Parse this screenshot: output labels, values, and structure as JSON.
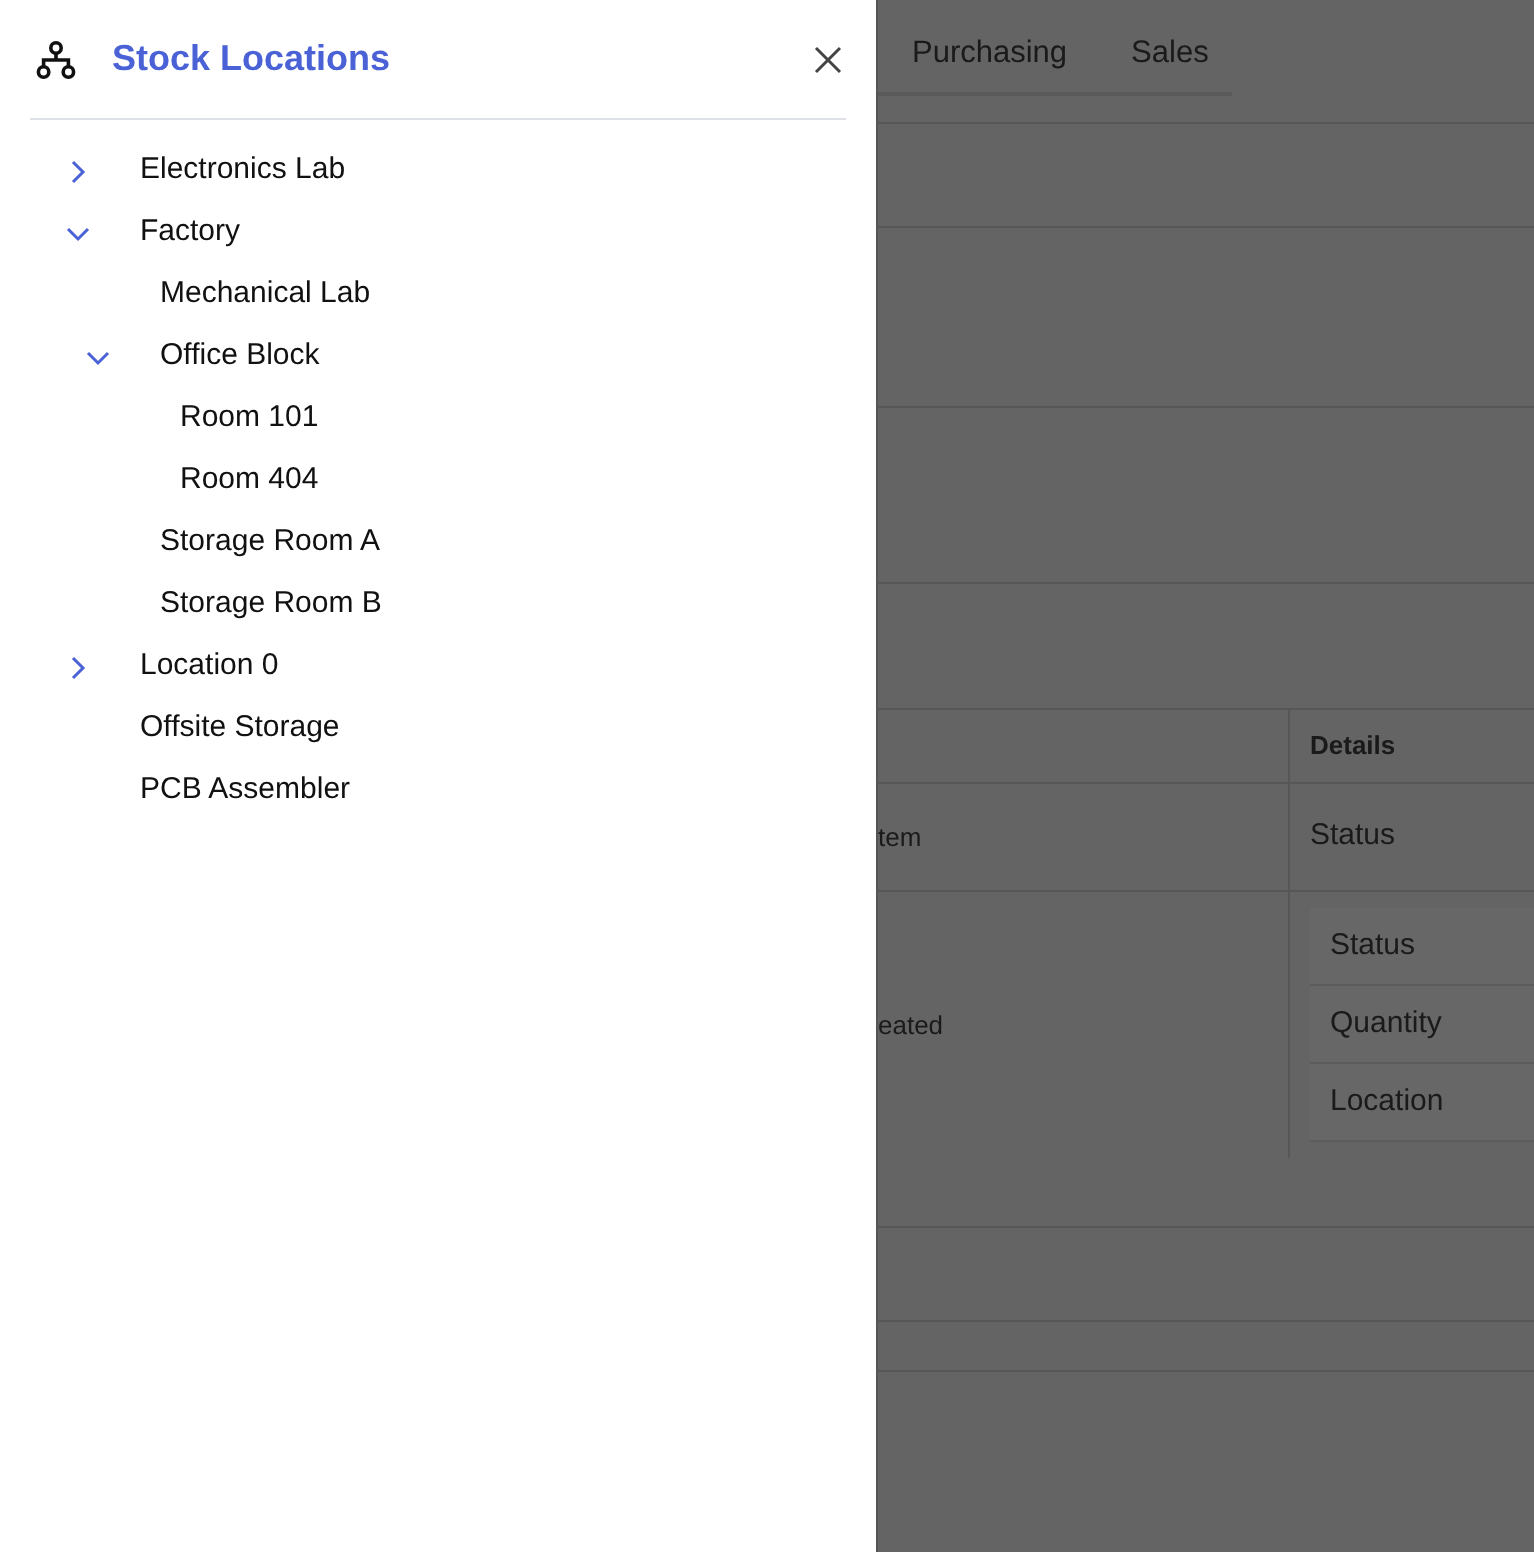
{
  "drawer": {
    "title": "Stock Locations",
    "tree": [
      {
        "label": "Electronics Lab",
        "kind": "folder",
        "expanded": false
      },
      {
        "label": "Factory",
        "kind": "folder",
        "expanded": true,
        "children": [
          {
            "label": "Mechanical Lab",
            "kind": "leaf"
          },
          {
            "label": "Office Block",
            "kind": "folder",
            "expanded": true,
            "children": [
              {
                "label": "Room 101",
                "kind": "leaf"
              },
              {
                "label": "Room 404",
                "kind": "leaf"
              }
            ]
          },
          {
            "label": "Storage Room A",
            "kind": "leaf"
          },
          {
            "label": "Storage Room B",
            "kind": "leaf"
          }
        ]
      },
      {
        "label": "Location 0",
        "kind": "folder",
        "expanded": false
      },
      {
        "label": "Offsite Storage",
        "kind": "leaf"
      },
      {
        "label": "PCB Assembler",
        "kind": "leaf"
      }
    ]
  },
  "background_page": {
    "tabs": [
      "Purchasing",
      "Sales"
    ],
    "table": {
      "columns": [
        "Details"
      ],
      "rows": [
        {
          "column_1": "tem",
          "details": [
            "Status"
          ]
        },
        {
          "column_1": "eated",
          "details": [
            "Status",
            "Quantity",
            "Location"
          ]
        }
      ]
    }
  }
}
